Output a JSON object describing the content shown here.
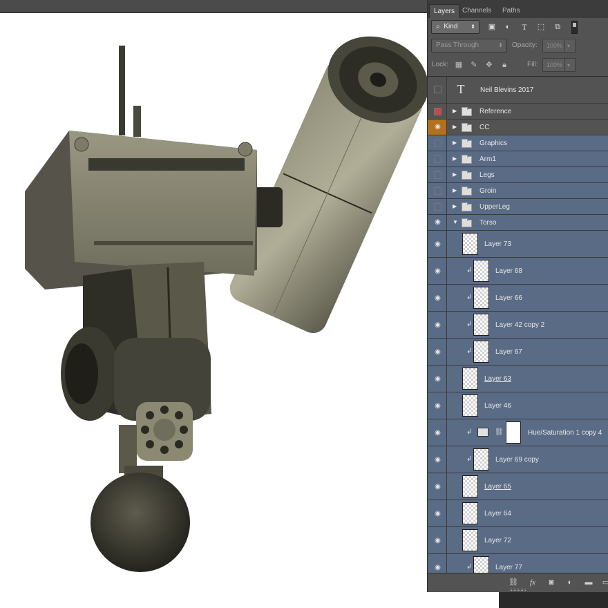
{
  "panel": {
    "tabs": [
      {
        "label": "Layers",
        "active": true
      },
      {
        "label": "Channels",
        "active": false
      },
      {
        "label": "Paths",
        "active": false
      }
    ],
    "filter": {
      "kind_label": "Kind",
      "search_icon": "magnifier-icon",
      "filter_icons": [
        "image-filter-icon",
        "adjustment-filter-icon",
        "type-filter-icon",
        "shape-filter-icon",
        "smart-object-filter-icon"
      ]
    },
    "blend": {
      "mode": "Pass Through",
      "opacity_label": "Opacity:",
      "opacity_value": "100%",
      "fill_label": "Fill:",
      "fill_value": "100%"
    },
    "lock": {
      "label": "Lock:"
    },
    "layers": [
      {
        "name": "Neil Blevins 2017",
        "type": "text",
        "visible": false
      },
      {
        "name": "Reference",
        "type": "group",
        "visible": false,
        "tag": "red",
        "expanded": false
      },
      {
        "name": "CC",
        "type": "group",
        "visible": true,
        "tag": "orange",
        "expanded": false
      },
      {
        "name": "Graphics",
        "type": "group",
        "visible": false,
        "selected": true,
        "expanded": false
      },
      {
        "name": "Arm1",
        "type": "group",
        "visible": false,
        "selected": true,
        "expanded": false
      },
      {
        "name": "Legs",
        "type": "group",
        "visible": false,
        "selected": true,
        "expanded": false
      },
      {
        "name": "Groin",
        "type": "group",
        "visible": false,
        "selected": true,
        "expanded": false
      },
      {
        "name": "UpperLeg",
        "type": "group",
        "visible": false,
        "selected": true,
        "expanded": false
      },
      {
        "name": "Torso",
        "type": "group",
        "visible": true,
        "selected": true,
        "expanded": true
      },
      {
        "name": "Layer 73",
        "type": "pixel",
        "visible": true,
        "selected": true,
        "clipped": false
      },
      {
        "name": "Layer 68",
        "type": "pixel",
        "visible": true,
        "selected": true,
        "clipped": true
      },
      {
        "name": "Layer 66",
        "type": "pixel",
        "visible": true,
        "selected": true,
        "clipped": true
      },
      {
        "name": "Layer 42 copy 2",
        "type": "pixel",
        "visible": true,
        "selected": true,
        "clipped": true
      },
      {
        "name": "Layer 67",
        "type": "pixel",
        "visible": true,
        "selected": true,
        "clipped": true
      },
      {
        "name": "Layer 63",
        "type": "pixel",
        "visible": true,
        "selected": true,
        "clipped": false,
        "underlined": true
      },
      {
        "name": "Layer 46",
        "type": "pixel",
        "visible": true,
        "selected": true,
        "clipped": false
      },
      {
        "name": "Hue/Saturation 1 copy 4",
        "type": "adjustment",
        "visible": true,
        "selected": true,
        "clipped": true
      },
      {
        "name": "Layer 69 copy",
        "type": "pixel",
        "visible": true,
        "selected": true,
        "clipped": true
      },
      {
        "name": "Layer 65",
        "type": "pixel",
        "visible": true,
        "selected": true,
        "clipped": false,
        "underlined": true
      },
      {
        "name": "Layer 64",
        "type": "pixel",
        "visible": true,
        "selected": true,
        "clipped": false
      },
      {
        "name": "Layer 72",
        "type": "pixel",
        "visible": true,
        "selected": true,
        "clipped": false
      },
      {
        "name": "Layer 77",
        "type": "pixel",
        "visible": true,
        "selected": true,
        "clipped": true
      }
    ],
    "bottom_icons": [
      "link-layers-icon",
      "fx-icon",
      "add-mask-icon",
      "adjustment-layer-icon",
      "new-group-icon",
      "new-layer-icon"
    ]
  },
  "colors": {
    "selected_row": "#5a6b85",
    "panel_bg": "#535353",
    "tag_red": "#c24a48",
    "tag_orange": "#b2711c"
  }
}
